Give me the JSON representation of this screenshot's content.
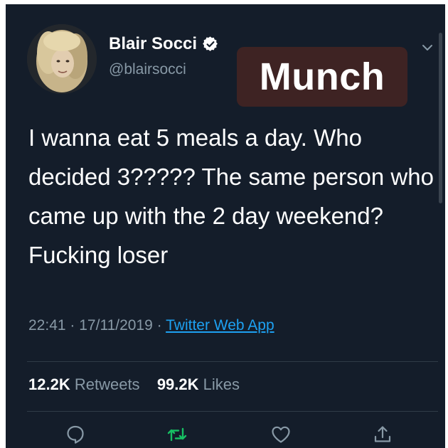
{
  "tweet": {
    "author": {
      "display_name": "Blair Socci",
      "handle": "@blairsocci",
      "verified": true
    },
    "overlay_label": "Munch",
    "text": "I wanna eat 5 meals a day. Who decided 3????? The same person who came up with the 2 day weekend? Fucking loser",
    "time": "22:41",
    "date": "17/11/2019",
    "separator": "·",
    "source": "Twitter Web App",
    "stats": {
      "retweets_count": "12.2K",
      "retweets_label": "Retweets",
      "likes_count": "99.2K",
      "likes_label": "Likes"
    },
    "icons": {
      "verified": "verified-badge-icon",
      "caret": "chevron-down-icon",
      "reply": "reply-icon",
      "retweet": "retweet-icon",
      "like": "heart-icon",
      "share": "share-icon"
    },
    "colors": {
      "background": "#141d2a",
      "secondary_text": "#8899a6",
      "link": "#1da1f2",
      "retweet_green": "#17bf63",
      "overlay_bg": "#3e2323"
    }
  }
}
